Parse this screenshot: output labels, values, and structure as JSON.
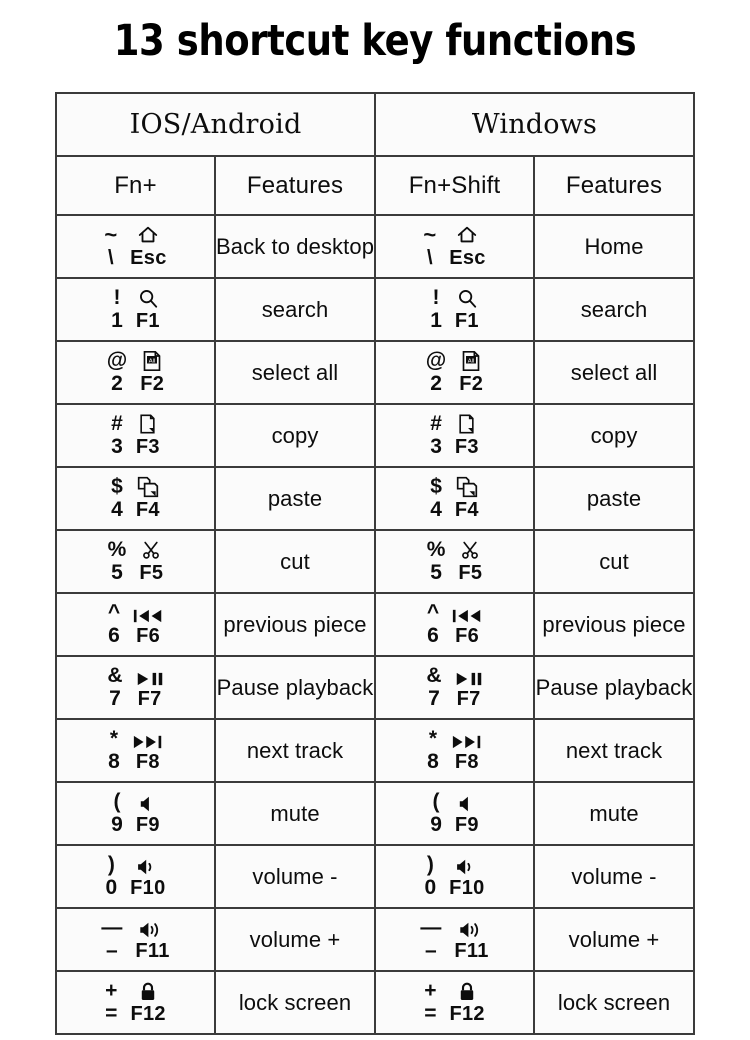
{
  "title": "13 shortcut key functions",
  "table": {
    "platforms": [
      {
        "label": "IOS/Android"
      },
      {
        "label": "Windows"
      }
    ],
    "subheaders": {
      "ios_key": "Fn+",
      "ios_features": "Features",
      "win_key": "Fn+Shift",
      "win_features": "Features"
    },
    "rows": [
      {
        "symbol": "~",
        "number": "\\",
        "fname": "Esc",
        "icon": "home-icon",
        "ios_feature": "Back to desktop",
        "win_feature": "Home"
      },
      {
        "symbol": "!",
        "number": "1",
        "fname": "F1",
        "icon": "search-icon",
        "ios_feature": "search",
        "win_feature": "search"
      },
      {
        "symbol": "@",
        "number": "2",
        "fname": "F2",
        "icon": "select-all-icon",
        "ios_feature": "select all",
        "win_feature": "select all"
      },
      {
        "symbol": "#",
        "number": "3",
        "fname": "F3",
        "icon": "copy-icon",
        "ios_feature": "copy",
        "win_feature": "copy"
      },
      {
        "symbol": "$",
        "number": "4",
        "fname": "F4",
        "icon": "paste-icon",
        "ios_feature": "paste",
        "win_feature": "paste"
      },
      {
        "symbol": "%",
        "number": "5",
        "fname": "F5",
        "icon": "scissors-icon",
        "ios_feature": "cut",
        "win_feature": "cut"
      },
      {
        "symbol": "^",
        "number": "6",
        "fname": "F6",
        "icon": "previous-track-icon",
        "ios_feature": "previous piece",
        "win_feature": "previous piece"
      },
      {
        "symbol": "&",
        "number": "7",
        "fname": "F7",
        "icon": "play-pause-icon",
        "ios_feature": "Pause playback",
        "win_feature": "Pause playback"
      },
      {
        "symbol": "*",
        "number": "8",
        "fname": "F8",
        "icon": "next-track-icon",
        "ios_feature": "next track",
        "win_feature": "next track"
      },
      {
        "symbol": "(",
        "number": "9",
        "fname": "F9",
        "icon": "mute-icon",
        "ios_feature": "mute",
        "win_feature": "mute"
      },
      {
        "symbol": ")",
        "number": "0",
        "fname": "F10",
        "icon": "volume-down-icon",
        "ios_feature": "volume -",
        "win_feature": "volume -"
      },
      {
        "symbol": "—",
        "number": "–",
        "fname": "F11",
        "icon": "volume-up-icon",
        "ios_feature": "volume +",
        "win_feature": "volume +"
      },
      {
        "symbol": "+",
        "number": "=",
        "fname": "F12",
        "icon": "lock-icon",
        "ios_feature": "lock screen",
        "win_feature": "lock screen"
      }
    ]
  },
  "colors": {
    "border": "#3b3b3b",
    "cell_bg": "#fbfbfb",
    "text": "#0d0d0d",
    "title": "#000000"
  }
}
